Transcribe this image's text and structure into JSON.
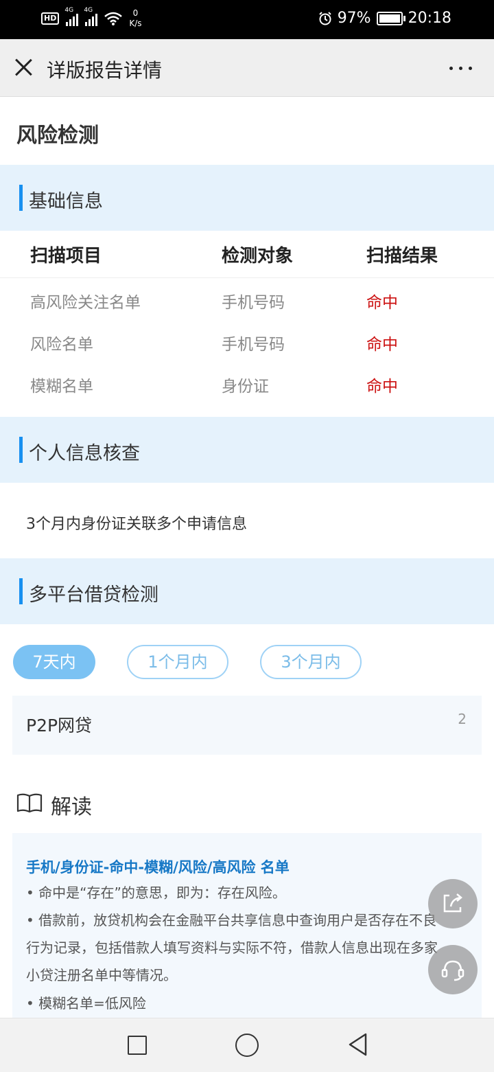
{
  "status_bar": {
    "hd": "HD",
    "signal1": "4G",
    "signal2": "4G",
    "speed_value": "0",
    "speed_unit": "K/s",
    "battery": "97%",
    "time": "20:18"
  },
  "nav": {
    "title": "详版报告详情"
  },
  "page_title": "风险检测",
  "sections": {
    "basic": "基础信息",
    "personal": "个人信息核查",
    "multi": "多平台借贷检测"
  },
  "table": {
    "headers": [
      "扫描项目",
      "检测对象",
      "扫描结果"
    ],
    "rows": [
      {
        "item": "高风险关注名单",
        "target": "手机号码",
        "result": "命中"
      },
      {
        "item": "风险名单",
        "target": "手机号码",
        "result": "命中"
      },
      {
        "item": "模糊名单",
        "target": "身份证",
        "result": "命中"
      }
    ]
  },
  "personal_info": "3个月内身份证关联多个申请信息",
  "tabs": [
    {
      "label": "7天内",
      "active": true
    },
    {
      "label": "1个月内",
      "active": false
    },
    {
      "label": "3个月内",
      "active": false
    }
  ],
  "p2p": {
    "name": "P2P网贷",
    "count": "2"
  },
  "interpretation": {
    "title": "解读",
    "card_title": "手机/身份证-命中-模糊/风险/高风险 名单",
    "lines": [
      "• 命中是“存在”的意思，即为：存在风险。",
      "• 借款前，放贷机构会在金融平台共享信息中查询用户是否存在不良",
      "行为记录，包括借款人填写资料与实际不符，借款人信息出现在多家",
      "小贷注册名单中等情况。",
      "• 模糊名单=低风险"
    ]
  },
  "colors": {
    "accent": "#1890f0",
    "hit": "#cc1111",
    "section_bg": "#e5f2fc",
    "card_title": "#1778c6"
  }
}
